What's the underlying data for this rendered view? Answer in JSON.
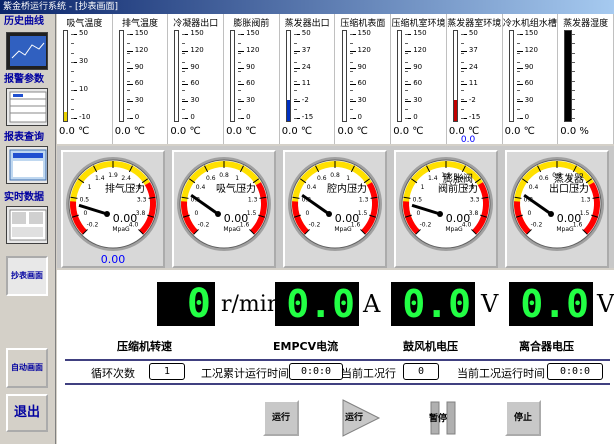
{
  "window": {
    "title": "紫金桥运行系统 - [抄表画面]"
  },
  "sidebar": {
    "history_label": "历史曲线",
    "alarm_label": "报警参数",
    "report_label": "报表查询",
    "realtime_label": "实时数据",
    "meter_button": "抄表画面",
    "auto_button": "自动画面",
    "exit_button": "退出"
  },
  "thermometers": [
    {
      "name": "吸气温度",
      "ticks": [
        "50",
        "30",
        "10",
        "-10"
      ],
      "value": "0.0",
      "unit": "℃",
      "level": 0.1,
      "fill": "#e8d000"
    },
    {
      "name": "排气温度",
      "ticks": [
        "150",
        "120",
        "90",
        "60",
        "30",
        "0"
      ],
      "value": "0.0",
      "unit": "℃",
      "level": 0,
      "fill": "#c00000"
    },
    {
      "name": "冷凝器出口",
      "ticks": [
        "150",
        "120",
        "90",
        "60",
        "30",
        "0"
      ],
      "value": "0.0",
      "unit": "℃",
      "level": 0,
      "fill": "#c00000"
    },
    {
      "name": "膨胀阀前",
      "ticks": [
        "150",
        "120",
        "90",
        "60",
        "30",
        "0"
      ],
      "value": "0.0",
      "unit": "℃",
      "level": 0,
      "fill": "#c00000"
    },
    {
      "name": "蒸发器出口",
      "ticks": [
        "50",
        "37",
        "24",
        "11",
        "-2",
        "-15"
      ],
      "value": "0.0",
      "unit": "℃",
      "level": 0.23,
      "fill": "#0030c0"
    },
    {
      "name": "压缩机表面",
      "ticks": [
        "150",
        "120",
        "90",
        "60",
        "30",
        "0"
      ],
      "value": "0.0",
      "unit": "℃",
      "level": 0,
      "fill": "#c00000"
    },
    {
      "name": "压缩机室环境",
      "ticks": [
        "150",
        "120",
        "90",
        "60",
        "30",
        "0"
      ],
      "value": "0.0",
      "unit": "℃",
      "level": 0,
      "fill": "#c00000"
    },
    {
      "name": "蒸发器室环境",
      "ticks": [
        "50",
        "37",
        "24",
        "11",
        "-2",
        "-15"
      ],
      "value": "0.0",
      "value2": "0.0",
      "unit": "℃",
      "level": 0.23,
      "fill": "#c00000"
    },
    {
      "name": "冷水机组水槽",
      "ticks": [
        "150",
        "120",
        "90",
        "60",
        "30",
        "0"
      ],
      "value": "0.0",
      "unit": "℃",
      "level": 0,
      "fill": "#c00000"
    },
    {
      "name": "蒸发器湿度",
      "ticks": [],
      "value": "0.0",
      "unit": "%",
      "level": 1,
      "fill": "#000000"
    }
  ],
  "gauges": [
    {
      "name": "排气压力",
      "lines": [
        "排气压力"
      ],
      "ticks": [
        "-0.2",
        "0",
        "0.5",
        "1",
        "1.4",
        "1.9",
        "2.4",
        "2.8",
        "3.3",
        "3.8",
        "4.0"
      ],
      "min": -0.2,
      "max": 4.0,
      "value": "0.00",
      "reading": 0,
      "unit": "MpaG",
      "below": "0.00"
    },
    {
      "name": "吸气压力",
      "lines": [
        "吸气压力"
      ],
      "ticks": [
        "-0.2",
        "0",
        "0.2",
        "0.4",
        "0.6",
        "0.8",
        "1",
        "1.1",
        "1.3",
        "1.5",
        "1.6"
      ],
      "min": -0.2,
      "max": 1.6,
      "value": "0.00",
      "reading": 0,
      "unit": "MpaG",
      "below": ""
    },
    {
      "name": "腔内压力",
      "lines": [
        "腔内压力"
      ],
      "ticks": [
        "-0.2",
        "0",
        "0.2",
        "0.4",
        "0.6",
        "0.8",
        "1",
        "1.1",
        "1.3",
        "1.5",
        "1.6"
      ],
      "min": -0.2,
      "max": 1.6,
      "value": "0.00",
      "reading": 0,
      "unit": "MpaG",
      "below": ""
    },
    {
      "name": "膨胀阀阀前压力",
      "lines": [
        "膨胀阀",
        "阀前压力"
      ],
      "ticks": [
        "-0.2",
        "0",
        "0.5",
        "1",
        "1.4",
        "1.9",
        "2.4",
        "2.8",
        "3.3",
        "3.8",
        "4.0"
      ],
      "min": -0.2,
      "max": 4.0,
      "value": "0.00",
      "reading": 0,
      "unit": "MpaG",
      "below": ""
    },
    {
      "name": "蒸发器出口压力",
      "lines": [
        "蒸发器",
        "出口压力"
      ],
      "ticks": [
        "-0.2",
        "0",
        "0.2",
        "0.4",
        "0.6",
        "0.8",
        "1",
        "1.1",
        "1.3",
        "1.5",
        "1.6"
      ],
      "min": -0.2,
      "max": 1.6,
      "value": "0.00",
      "reading": 0,
      "unit": "MpaG",
      "below": ""
    }
  ],
  "digital": {
    "compressor": {
      "value": "0",
      "unit": "r/min",
      "label": "压缩机转速"
    },
    "epmcv": {
      "value": "0.0",
      "unit": "A",
      "label": "EMPCV电流"
    },
    "fan": {
      "value": "0.0",
      "unit": "V",
      "label": "鼓风机电压"
    },
    "separator": {
      "value": "0.0",
      "unit": "V",
      "label": "离合器电压"
    }
  },
  "info": {
    "cycle_label": "循环次数",
    "cycle_value": "1",
    "cumulative_label": "工况累计运行时间",
    "cumulative_value": "0:0:0",
    "condition_label": "当前工况行",
    "condition_value": "0",
    "current_time_label": "当前工况运行时间",
    "current_time_value": "0:0:0"
  },
  "controls": {
    "run1": "运行",
    "run2": "运行",
    "pause": "暂停",
    "stop": "停止"
  }
}
